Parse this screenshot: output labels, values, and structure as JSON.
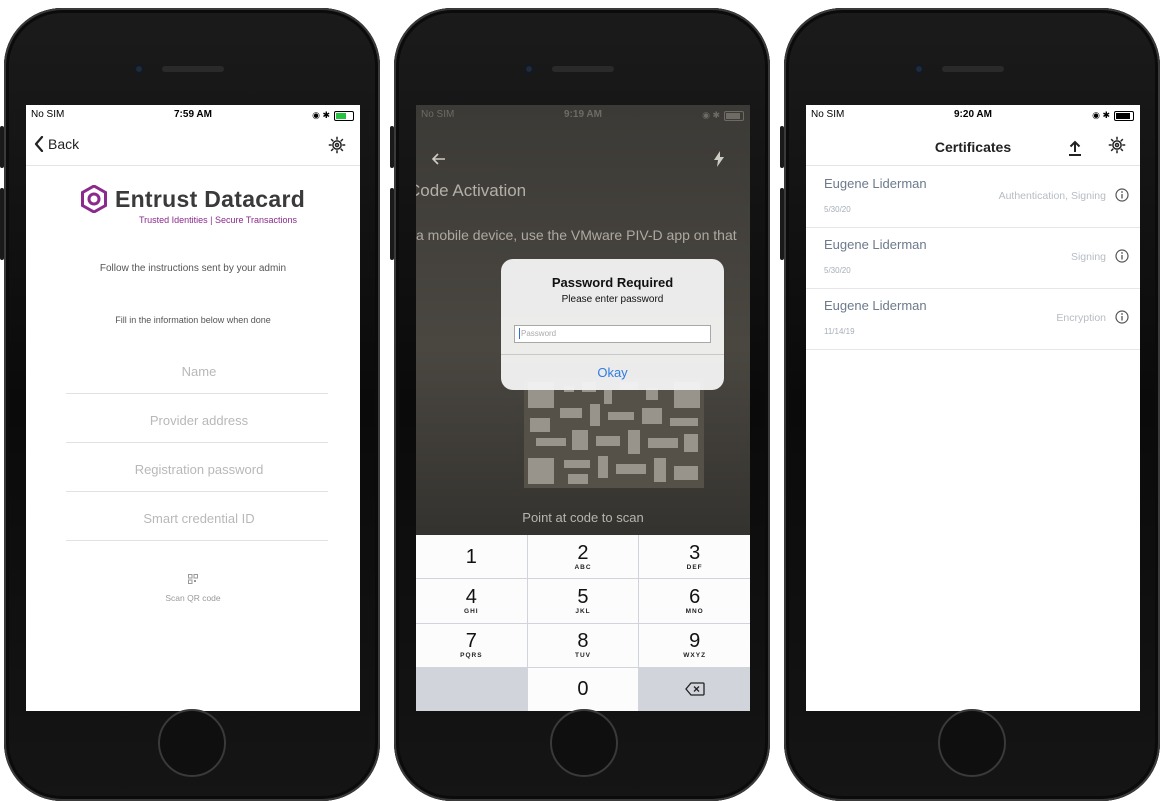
{
  "screen1": {
    "status": {
      "carrier": "No SIM",
      "time": "7:59 AM"
    },
    "nav": {
      "back_label": "Back",
      "settings_icon": "gear-icon"
    },
    "logo": {
      "name": "Entrust Datacard",
      "tagline": "Trusted Identities | Secure Transactions",
      "brand_color": "#8b2a8c"
    },
    "instructions": "Follow the instructions sent by your admin",
    "fill_in": "Fill in the information below when done",
    "fields": {
      "name_placeholder": "Name",
      "provider_placeholder": "Provider address",
      "password_placeholder": "Registration password",
      "credential_placeholder": "Smart credential ID"
    },
    "scan_label": "Scan QR code"
  },
  "screen2": {
    "status": {
      "carrier": "No SIM",
      "time": "9:19 AM"
    },
    "title": "Code Activation",
    "description": "a mobile device, use the VMware PIV-D app on that",
    "scan_hint": "Point at code to scan",
    "dialog": {
      "title": "Password Required",
      "message": "Please enter password",
      "input_placeholder": "Password",
      "button": "Okay",
      "button_color": "#2f7ce0"
    },
    "keypad": [
      {
        "digit": "1",
        "letters": ""
      },
      {
        "digit": "2",
        "letters": "ABC"
      },
      {
        "digit": "3",
        "letters": "DEF"
      },
      {
        "digit": "4",
        "letters": "GHI"
      },
      {
        "digit": "5",
        "letters": "JKL"
      },
      {
        "digit": "6",
        "letters": "MNO"
      },
      {
        "digit": "7",
        "letters": "PQRS"
      },
      {
        "digit": "8",
        "letters": "TUV"
      },
      {
        "digit": "9",
        "letters": "WXYZ"
      },
      {
        "digit": "0",
        "letters": ""
      }
    ]
  },
  "screen3": {
    "status": {
      "carrier": "No SIM",
      "time": "9:20 AM"
    },
    "title": "Certificates",
    "certificates": [
      {
        "name": "Eugene Liderman",
        "date": "5/30/20",
        "usage": "Authentication, Signing"
      },
      {
        "name": "Eugene Liderman",
        "date": "5/30/20",
        "usage": "Signing"
      },
      {
        "name": "Eugene Liderman",
        "date": "11/14/19",
        "usage": "Encryption"
      }
    ]
  }
}
